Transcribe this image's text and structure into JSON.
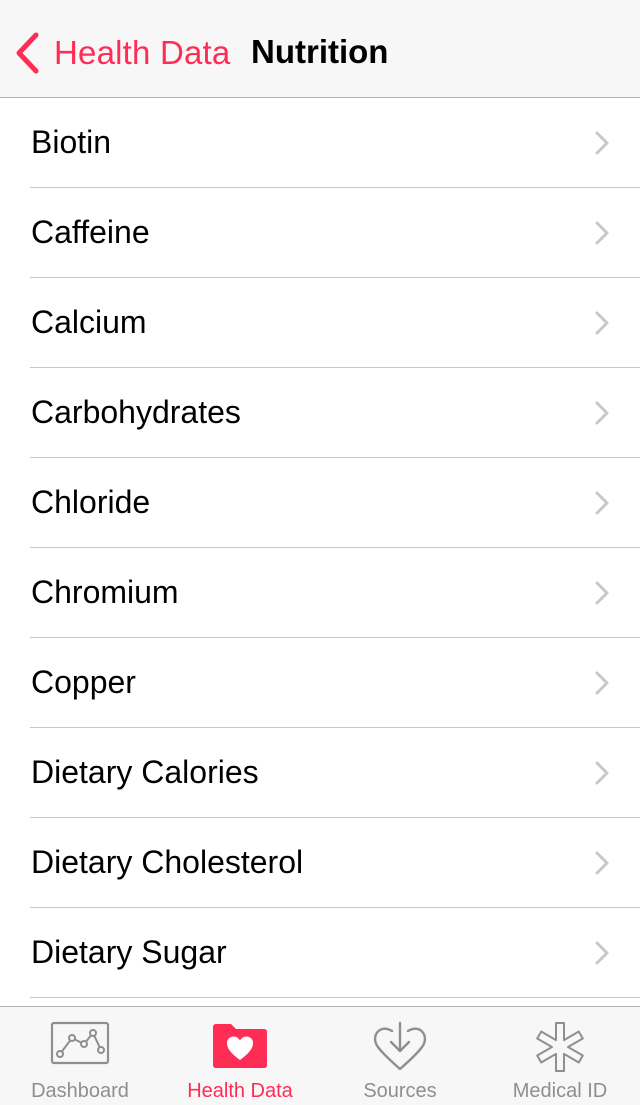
{
  "navbar": {
    "back_label": "Health Data",
    "title": "Nutrition"
  },
  "list": {
    "items": [
      {
        "label": "Biotin"
      },
      {
        "label": "Caffeine"
      },
      {
        "label": "Calcium"
      },
      {
        "label": "Carbohydrates"
      },
      {
        "label": "Chloride"
      },
      {
        "label": "Chromium"
      },
      {
        "label": "Copper"
      },
      {
        "label": "Dietary Calories"
      },
      {
        "label": "Dietary Cholesterol"
      },
      {
        "label": "Dietary Sugar"
      }
    ]
  },
  "tabbar": {
    "tabs": [
      {
        "label": "Dashboard",
        "icon": "dashboard-chart-icon"
      },
      {
        "label": "Health Data",
        "icon": "heart-folder-icon",
        "active": true
      },
      {
        "label": "Sources",
        "icon": "heart-download-icon"
      },
      {
        "label": "Medical ID",
        "icon": "medical-star-icon"
      }
    ]
  },
  "colors": {
    "accent": "#ff2d55",
    "inactive": "#8e8e93",
    "separator": "#c8c7cc",
    "chevron": "#c7c7cc",
    "bar_background": "#f7f7f7"
  }
}
